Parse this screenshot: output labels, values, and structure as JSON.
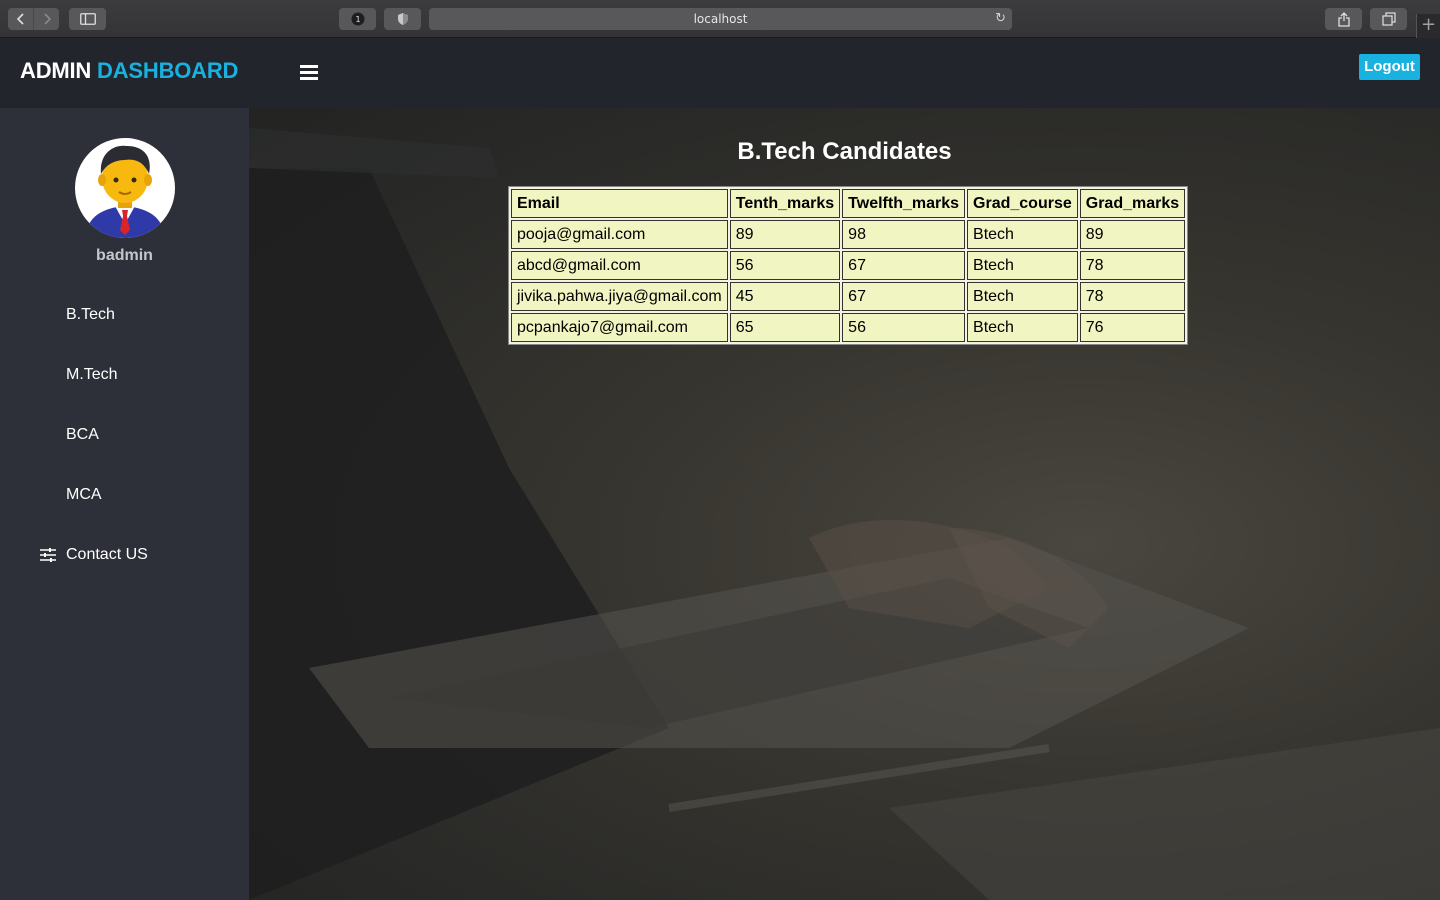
{
  "browser": {
    "url": "localhost",
    "badge_count": "1"
  },
  "header": {
    "brand_part1": "ADMIN",
    "brand_part2": "DASHBOARD",
    "logout_label": "Logout",
    "accent_color": "#19b1df"
  },
  "sidebar": {
    "username": "badmin",
    "items": [
      {
        "label": "B.Tech",
        "icon": "grid-icon"
      },
      {
        "label": "M.Tech",
        "icon": "grid-icon"
      },
      {
        "label": "BCA",
        "icon": "grid-icon"
      },
      {
        "label": "MCA",
        "icon": "grid-icon"
      },
      {
        "label": "Contact US",
        "icon": "sliders-icon"
      }
    ]
  },
  "main": {
    "title": "B.Tech Candidates",
    "table": {
      "headers": [
        "Email",
        "Tenth_marks",
        "Twelfth_marks",
        "Grad_course",
        "Grad_marks"
      ],
      "rows": [
        [
          "pooja@gmail.com",
          "89",
          "98",
          "Btech",
          "89"
        ],
        [
          "abcd@gmail.com",
          "56",
          "67",
          "Btech",
          "78"
        ],
        [
          "jivika.pahwa.jiya@gmail.com",
          "45",
          "67",
          "Btech",
          "78"
        ],
        [
          "pcpankajo7@gmail.com",
          "65",
          "56",
          "Btech",
          "76"
        ]
      ]
    }
  }
}
